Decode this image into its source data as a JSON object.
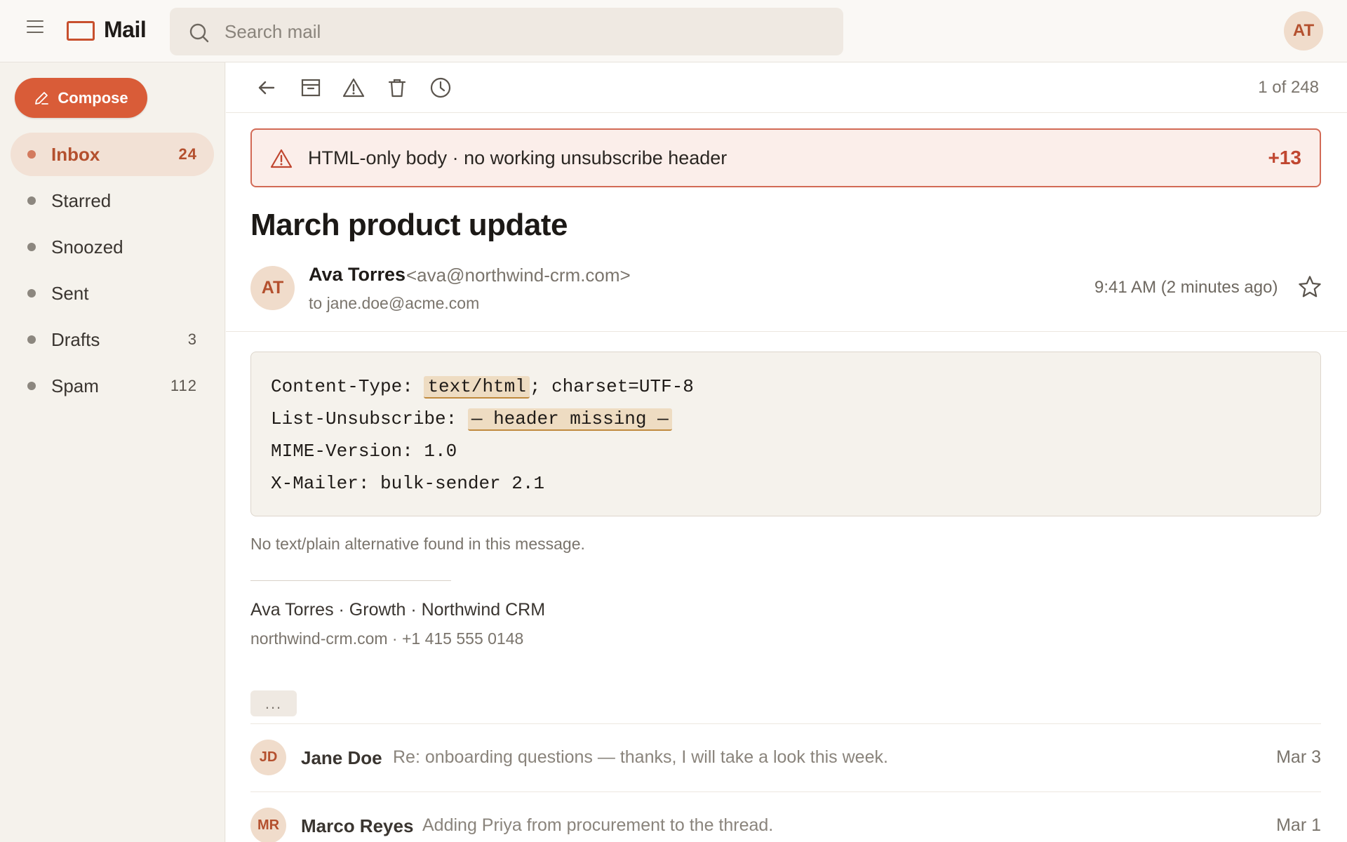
{
  "app": {
    "title": "Mail"
  },
  "search": {
    "placeholder": "Search mail"
  },
  "user": {
    "initials": "AT"
  },
  "sidebar": {
    "compose_label": "Compose",
    "items": [
      {
        "label": "Inbox",
        "count": "24",
        "active": true
      },
      {
        "label": "Starred",
        "count": ""
      },
      {
        "label": "Snoozed",
        "count": ""
      },
      {
        "label": "Sent",
        "count": ""
      },
      {
        "label": "Drafts",
        "count": "3"
      },
      {
        "label": "Spam",
        "count": "112"
      }
    ]
  },
  "toolbar": {
    "icons": [
      "back-arrow-icon",
      "archive-icon",
      "report-spam-icon",
      "delete-icon",
      "snooze-clock-icon"
    ],
    "pager": "1 of 248"
  },
  "warning": {
    "text": "HTML-only body · no working unsubscribe header",
    "count": "+13"
  },
  "message": {
    "subject": "March product update",
    "sender_initials": "AT",
    "sender_name": "Ava Torres",
    "sender_email": "<ava@northwind-crm.com>",
    "recipient": "to jane.doe@acme.com",
    "timestamp": "9:41 AM (2 minutes ago)",
    "headers": {
      "content_type_key": "Content-Type: ",
      "content_type_val": "text/html",
      "content_type_rest": "; charset=UTF-8",
      "unsub_key": "List-Unsubscribe: ",
      "unsub_val": "— header missing —",
      "mime": "MIME-Version: 1.0",
      "mailer": "X-Mailer: bulk-sender 2.1"
    },
    "note": "No text/plain alternative found in this message.",
    "signature_line1": "Ava Torres · Growth · Northwind CRM",
    "signature_line2": "northwind-crm.com · +1 415 555 0148",
    "ellipsis": "..."
  },
  "thread": [
    {
      "initials": "JD",
      "name": "Jane Doe",
      "snippet": "Re: onboarding questions — thanks, I will take a look this week.",
      "date": "Mar 3"
    },
    {
      "initials": "MR",
      "name": "Marco Reyes",
      "snippet": "Adding Priya from procurement to the thread.",
      "date": "Mar 1"
    }
  ],
  "colors": {
    "accent": "#d95c38",
    "warning_border": "#d26a56",
    "warning_bg": "#fbeeea"
  }
}
